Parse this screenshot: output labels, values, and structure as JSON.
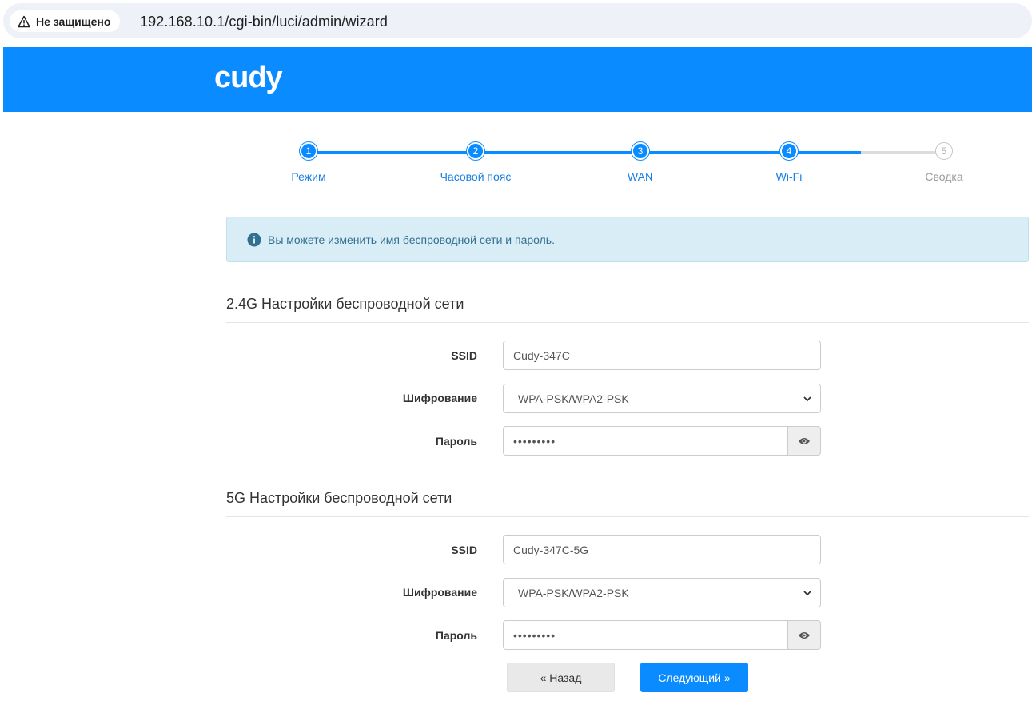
{
  "browser": {
    "security_label": "Не защищено",
    "url": "192.168.10.1/cgi-bin/luci/admin/wizard"
  },
  "brand": {
    "logo_text": "cudy",
    "color": "#0a8bff"
  },
  "stepper": {
    "steps": [
      {
        "number": "1",
        "label": "Режим",
        "state": "done"
      },
      {
        "number": "2",
        "label": "Часовой пояс",
        "state": "done"
      },
      {
        "number": "3",
        "label": "WAN",
        "state": "done"
      },
      {
        "number": "4",
        "label": "Wi-Fi",
        "state": "current"
      },
      {
        "number": "5",
        "label": "Сводка",
        "state": "pending"
      }
    ]
  },
  "alert": {
    "icon": "info-circle-icon",
    "text": "Вы можете изменить имя беспроводной сети и пароль."
  },
  "wifi24": {
    "title": "2.4G Настройки беспроводной сети",
    "ssid_label": "SSID",
    "ssid_value": "Cudy-347C",
    "encryption_label": "Шифрование",
    "encryption_value": "WPA-PSK/WPA2-PSK",
    "password_label": "Пароль",
    "password_mask": "•••••••••"
  },
  "wifi5": {
    "title": "5G Настройки беспроводной сети",
    "ssid_label": "SSID",
    "ssid_value": "Cudy-347C-5G",
    "encryption_label": "Шифрование",
    "encryption_value": "WPA-PSK/WPA2-PSK",
    "password_label": "Пароль",
    "password_mask": "•••••••••"
  },
  "actions": {
    "back_label": "« Назад",
    "next_label": "Следующий »"
  }
}
